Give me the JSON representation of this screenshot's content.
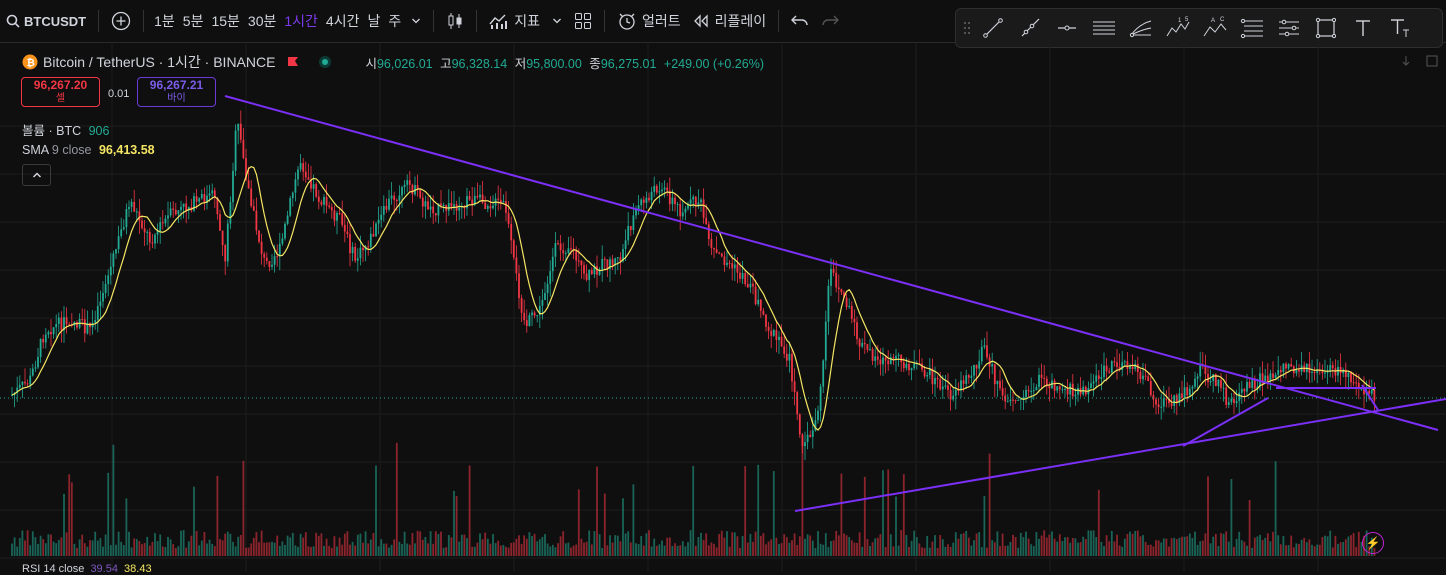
{
  "toolbar": {
    "symbol": "BTCUSDT",
    "intervals": [
      "1분",
      "5분",
      "15분",
      "30분",
      "1시간",
      "4시간",
      "날",
      "주"
    ],
    "active_interval": "1시간",
    "indicators_label": "지표",
    "alert_label": "얼러트",
    "replay_label": "리플레이"
  },
  "legend": {
    "title": "Bitcoin / TetherUS · 1시간 · BINANCE",
    "open_label": "시",
    "open": "96,026.01",
    "high_label": "고",
    "high": "96,328.14",
    "low_label": "저",
    "low": "95,800.00",
    "close_label": "종",
    "close": "96,275.01",
    "change": "+249.00 (+0.26%)"
  },
  "trade": {
    "sell_price": "96,267.20",
    "sell_label": "셀",
    "spread": "0.01",
    "buy_price": "96,267.21",
    "buy_label": "바이"
  },
  "indicators": {
    "volume_label": "볼륨 · BTC",
    "volume_value": "906",
    "sma_label": "SMA",
    "sma_params": "9 close",
    "sma_value": "96,413.58",
    "rsi_label": "RSI 14 close",
    "rsi_value1": "39.54",
    "rsi_value2": "38.43"
  },
  "colors": {
    "up": "#22ab94",
    "down": "#f23645",
    "sma": "#f5e663",
    "trendline": "#7b2ff7",
    "accent": "#7c3aed"
  },
  "chart_data": {
    "type": "candlestick",
    "sma_period": 9,
    "last_close": 96275.01
  }
}
